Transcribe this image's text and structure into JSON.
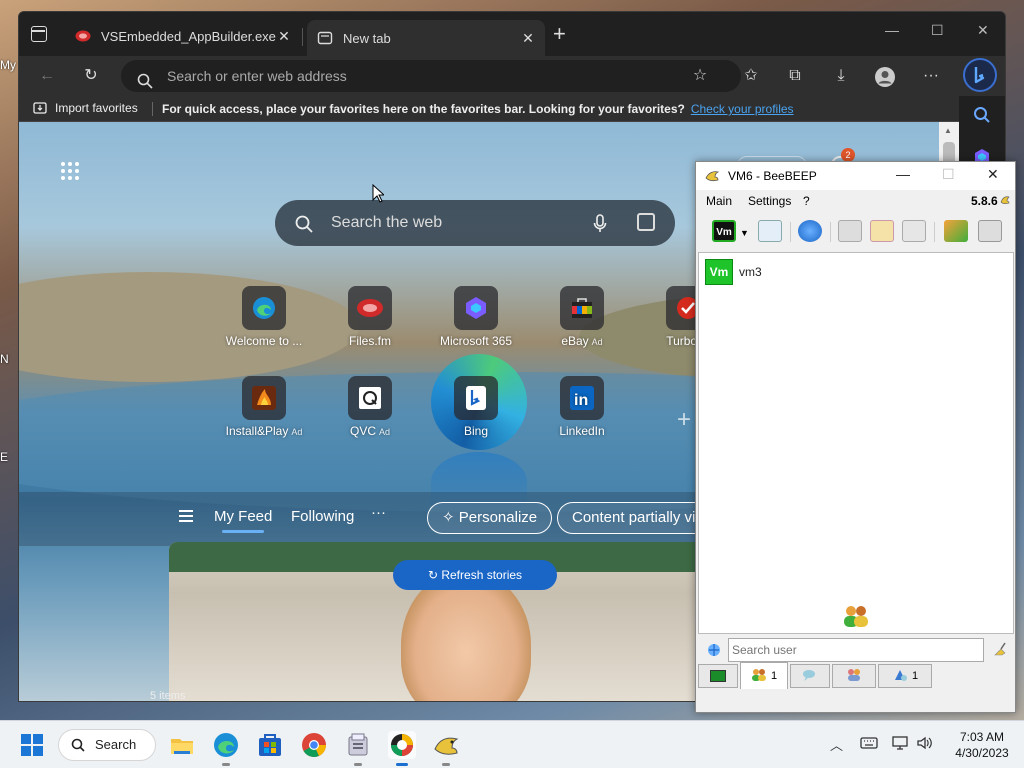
{
  "desktop": {
    "labels": [
      "My",
      "N",
      "E"
    ]
  },
  "browser": {
    "tabs": [
      {
        "title": "VSEmbedded_AppBuilder.exe and",
        "icon": "filesfm-icon",
        "active": false
      },
      {
        "title": "New tab",
        "icon": "newtab-icon",
        "active": true
      }
    ],
    "address_placeholder": "Search or enter web address",
    "favorites_bar": {
      "import_label": "Import favorites",
      "message": "For quick access, place your favorites here on the favorites bar. Looking for your favorites?",
      "link": "Check your profiles"
    },
    "ntp": {
      "search_placeholder": "Search the web",
      "quick_links": [
        {
          "label": "Welcome to ...",
          "ad": "",
          "icon": "edge-icon"
        },
        {
          "label": "Files.fm",
          "ad": "",
          "icon": "filesfm-icon"
        },
        {
          "label": "Microsoft 365",
          "ad": "",
          "icon": "m365-icon"
        },
        {
          "label": "eBay",
          "ad": "Ad",
          "icon": "ebay-icon"
        },
        {
          "label": "TurboTa",
          "ad": "",
          "icon": "turbotax-icon"
        },
        {
          "label": "Install&Play",
          "ad": "Ad",
          "icon": "installplay-icon"
        },
        {
          "label": "QVC",
          "ad": "Ad",
          "icon": "qvc-icon"
        },
        {
          "label": "Bing",
          "ad": "",
          "icon": "bing-icon"
        },
        {
          "label": "LinkedIn",
          "ad": "",
          "icon": "linkedin-icon"
        }
      ],
      "feed": {
        "tabs": [
          "My Feed",
          "Following",
          "···"
        ],
        "personalize": "Personalize",
        "content_pill": "Content partially visi",
        "refresh": "Refresh stories",
        "items": "5 items"
      },
      "notification_count": "2"
    }
  },
  "beebeep": {
    "title": "VM6 - BeeBEEP",
    "version": "5.8.6",
    "menu": [
      "Main",
      "Settings",
      "?"
    ],
    "users": [
      {
        "badge": "Vm",
        "name": "vm3"
      }
    ],
    "search_placeholder": "Search user",
    "bottom_tabs": [
      {
        "icon": "monitor-icon",
        "count": ""
      },
      {
        "icon": "users-icon",
        "count": "1"
      },
      {
        "icon": "chat-icon",
        "count": ""
      },
      {
        "icon": "groups-icon",
        "count": ""
      },
      {
        "icon": "share-icon",
        "count": "1"
      }
    ]
  },
  "taskbar": {
    "search_label": "Search",
    "time": "7:03 AM",
    "date": "4/30/2023"
  },
  "colors": {
    "edge_dark": "#202020",
    "accent_blue": "#1a66c7",
    "link_blue": "#4aa3f0",
    "vm_green": "#1fc42a"
  }
}
